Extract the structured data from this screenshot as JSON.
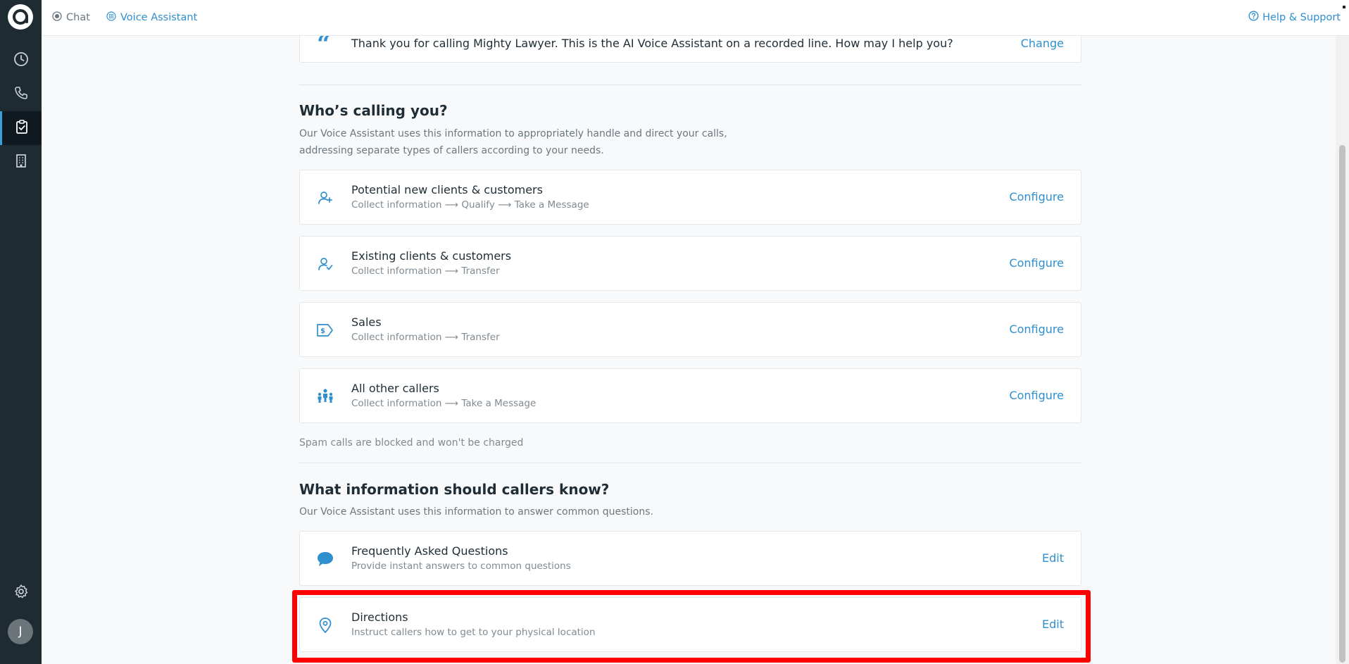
{
  "sidebar": {
    "logo": "app-logo",
    "items": [
      {
        "icon": "history-clock-icon",
        "name": "nav-history"
      },
      {
        "icon": "phone-icon",
        "name": "nav-calls"
      },
      {
        "icon": "clipboard-check-icon",
        "name": "nav-tasks"
      },
      {
        "icon": "building-icon",
        "name": "nav-business"
      }
    ],
    "settings_icon": "gear-icon",
    "avatar_initial": "J"
  },
  "topbar": {
    "tabs": [
      {
        "label": "Chat",
        "icon": "radio-dot-icon"
      },
      {
        "label": "Voice Assistant",
        "icon": "grid-dots-icon"
      }
    ],
    "help_label": "Help & Support"
  },
  "greeting": {
    "text": "Thank you for calling Mighty Lawyer. This is the AI Voice Assistant on a recorded line. How may I help you?",
    "action": "Change"
  },
  "callers_section": {
    "heading": "Who’s calling you?",
    "description_line1": "Our Voice Assistant uses this information to appropriately handle and direct your calls,",
    "description_line2": "addressing separate types of callers according to your needs.",
    "items": [
      {
        "title": "Potential new clients & customers",
        "subtitle": "Collect information ⟶ Qualify ⟶ Take a Message",
        "action": "Configure",
        "icon": "user-plus-icon"
      },
      {
        "title": "Existing clients & customers",
        "subtitle": "Collect information ⟶ Transfer",
        "action": "Configure",
        "icon": "user-check-icon"
      },
      {
        "title": "Sales",
        "subtitle": "Collect information ⟶ Transfer",
        "action": "Configure",
        "icon": "price-tag-icon"
      },
      {
        "title": "All other callers",
        "subtitle": "Collect information ⟶ Take a Message",
        "action": "Configure",
        "icon": "people-group-icon"
      }
    ],
    "spam_note": "Spam calls are blocked and won't be charged"
  },
  "info_section": {
    "heading": "What information should callers know?",
    "description": "Our Voice Assistant uses this information to answer common questions.",
    "items": [
      {
        "title": "Frequently Asked Questions",
        "subtitle": "Provide instant answers to common questions",
        "action": "Edit",
        "icon": "chat-bubble-icon"
      },
      {
        "title": "Directions",
        "subtitle": "Instruct callers how to get to your physical location",
        "action": "Edit",
        "icon": "location-pin-icon"
      }
    ]
  },
  "colors": {
    "accent": "#2f8fcf",
    "sidebar": "#1e2b33",
    "highlight": "#ff0000"
  }
}
